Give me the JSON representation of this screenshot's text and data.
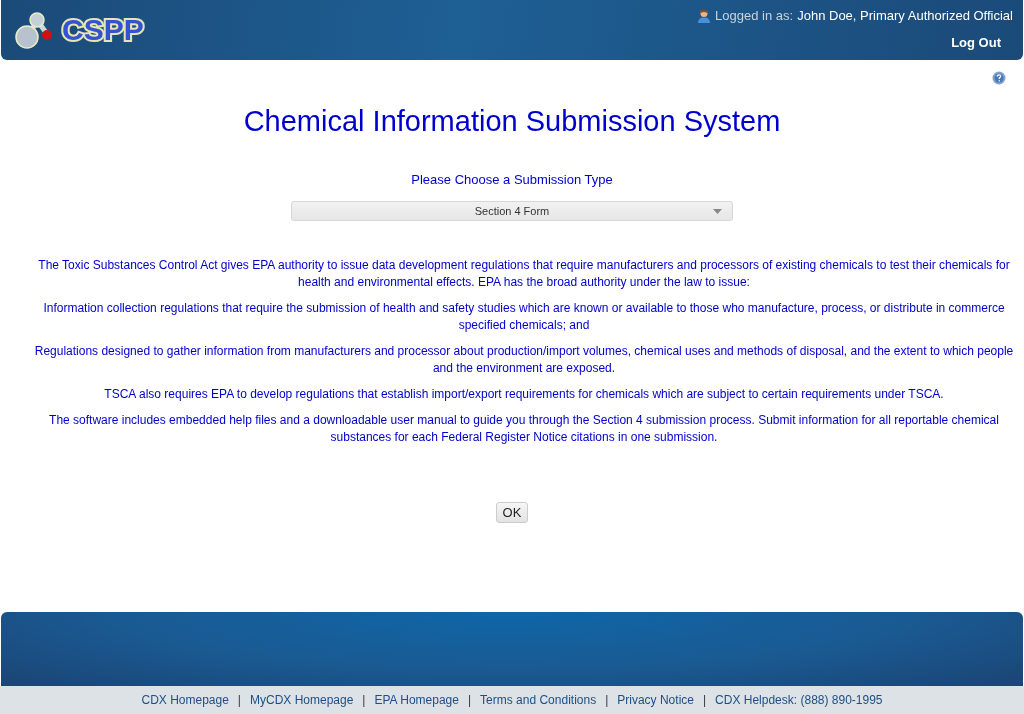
{
  "header": {
    "logo_text": "CSPP",
    "user_label": "Logged in as:",
    "user_name": "John Doe, Primary Authorized Official",
    "logout": "Log Out"
  },
  "title": "Chemical Information Submission System",
  "chooser": {
    "label": "Please Choose a Submission Type",
    "value": "Section 4 Form"
  },
  "paragraphs": [
    "The Toxic Substances Control Act gives EPA authority to issue data development regulations that require manufacturers and processors of existing chemicals to test their chemicals for health and environmental effects. EPA has the broad authority under the law to issue:",
    "Information collection regulations that require the submission of health and safety studies which are known or available to those who manufacture, process, or distribute in commerce specified chemicals; and",
    "Regulations designed to gather information from manufacturers and processor about production/import volumes, chemical uses and methods of disposal, and the extent to which people and the environment are exposed.",
    "TSCA also requires EPA to develop regulations that establish import/export requirements for chemicals which are subject to certain requirements under TSCA.",
    "The software includes embedded help files and a downloadable user manual to guide you through the Section 4 submission process. Submit information for all reportable chemical substances for each Federal Register Notice citations in one submission."
  ],
  "ok_button": "OK",
  "footer": [
    {
      "kind": "link",
      "text": "CDX Homepage"
    },
    {
      "kind": "separator",
      "text": "|"
    },
    {
      "kind": "link",
      "text": "MyCDX Homepage"
    },
    {
      "kind": "separator",
      "text": "|"
    },
    {
      "kind": "link",
      "text": "EPA Homepage"
    },
    {
      "kind": "separator",
      "text": "|"
    },
    {
      "kind": "link",
      "text": "Terms and Conditions"
    },
    {
      "kind": "separator",
      "text": "|"
    },
    {
      "kind": "link",
      "text": "Privacy Notice"
    },
    {
      "kind": "separator",
      "text": "|"
    },
    {
      "kind": "link",
      "text": "CDX Helpdesk: (888) 890-1995"
    }
  ]
}
